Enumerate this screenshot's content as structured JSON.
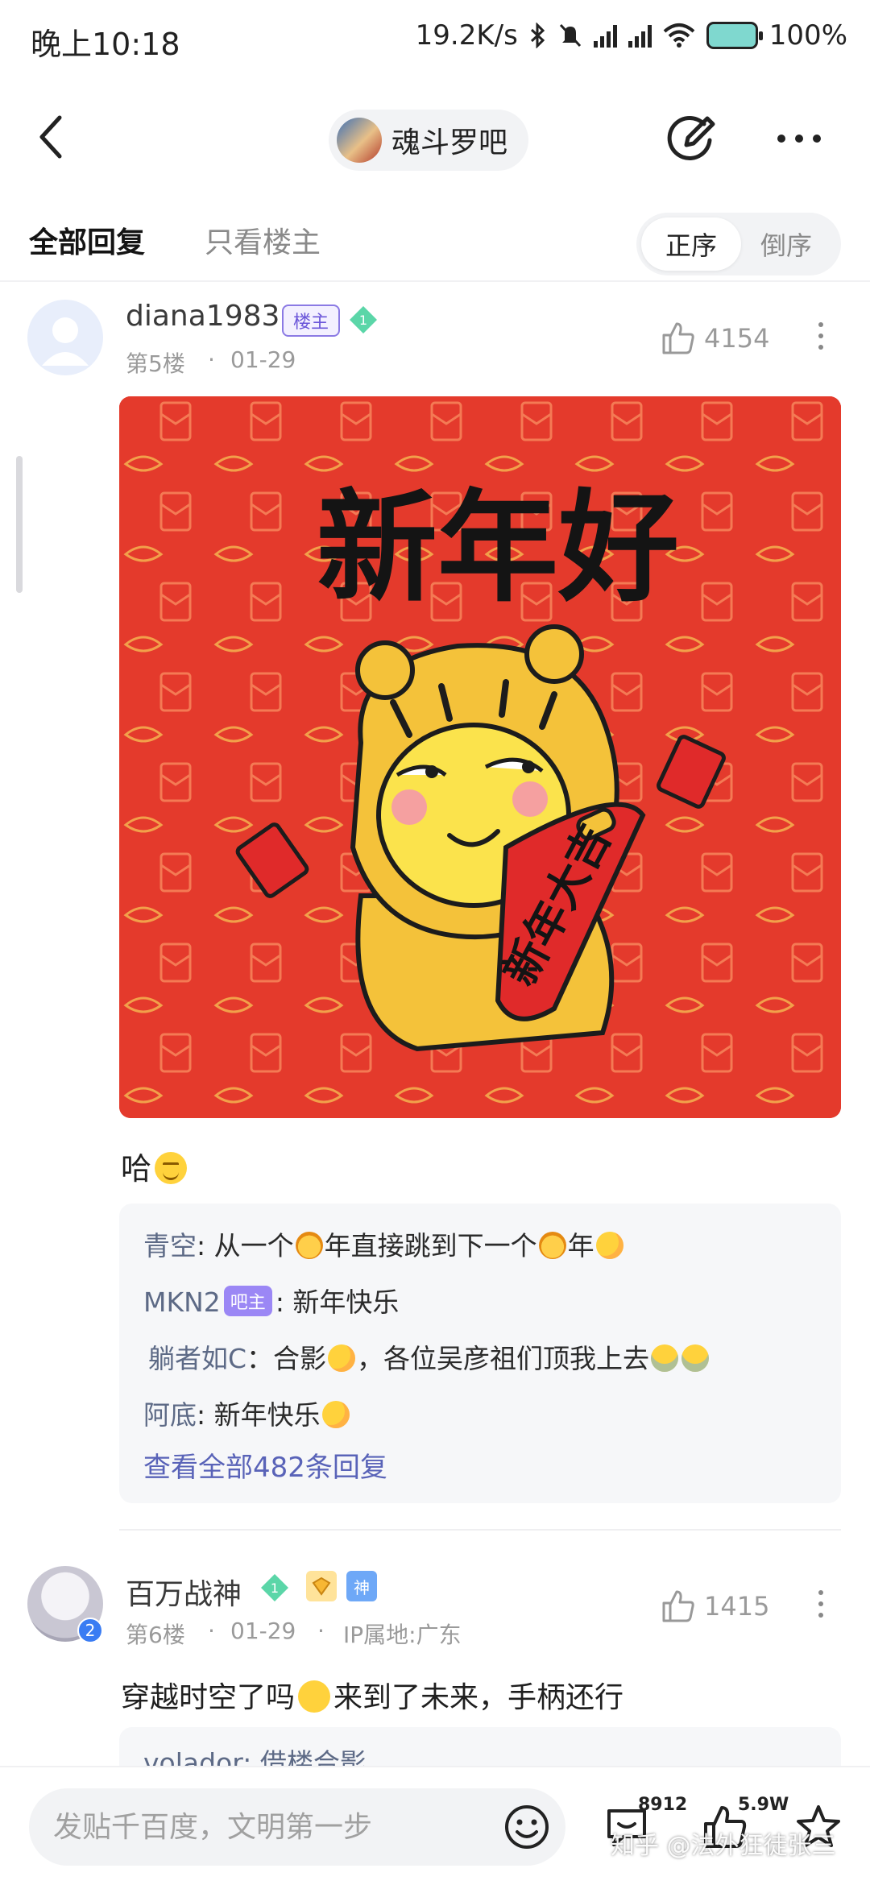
{
  "status_bar": {
    "time": "晚上10:18",
    "net_speed": "19.2K/s",
    "battery": "100%"
  },
  "header": {
    "forum_name": "魂斗罗吧"
  },
  "tabs": {
    "all": "全部回复",
    "op_only": "只看楼主",
    "order_asc": "正序",
    "order_desc": "倒序"
  },
  "post1": {
    "username": "diana1983",
    "op_tag": "楼主",
    "level": "1",
    "floor": "第5楼",
    "date": "01-29",
    "likes": "4154",
    "image_text": {
      "title": "新年好",
      "scroll": "新年大吉"
    },
    "text": "哈",
    "replies": [
      {
        "user": "青空",
        "sep": ":",
        "p1": " 从一个",
        "p2": "年直接跳到下一个",
        "p3": "年"
      },
      {
        "user": "MKN2",
        "badge": "吧主",
        "sep": ":",
        "text": " 新年快乐"
      },
      {
        "user": "躺者如C",
        "sep": "：",
        "text": "合影",
        "text2": "，各位吴彦祖们顶我上去"
      },
      {
        "user": "阿底",
        "sep": ":",
        "text": " 新年快乐"
      }
    ],
    "view_all": "查看全部482条回复"
  },
  "post2": {
    "username": "百万战神",
    "level": "1",
    "badge_god": "神",
    "verify": "2",
    "floor": "第6楼",
    "date": "01-29",
    "ip": "IP属地:广东",
    "likes": "1415",
    "text_a": "穿越时空了吗",
    "text_b": "来到了未来，手柄还行",
    "peek_reply": "volador: 借楼合影"
  },
  "bottom_bar": {
    "placeholder": "发贴千百度，文明第一步",
    "comments_count": "8912",
    "likes_count": "5.9W"
  },
  "watermark": "知乎 @法外狂徒张三",
  "colors": {
    "accent": "#5963b8",
    "op_tag": "#6a55d9",
    "admin_badge": "#9b87f5",
    "image_bg": "#e43a2c"
  }
}
